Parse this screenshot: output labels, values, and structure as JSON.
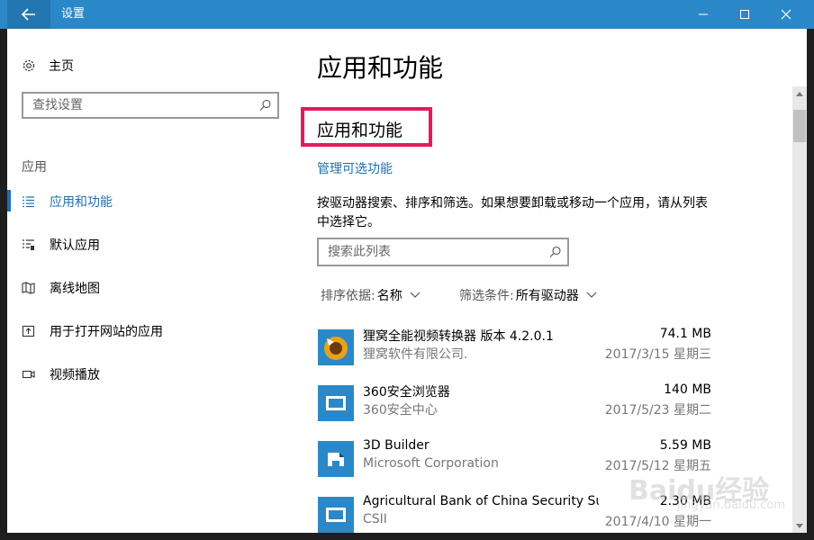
{
  "window": {
    "title": "设置"
  },
  "sidebar": {
    "home_label": "主页",
    "search_placeholder": "查找设置",
    "section": "应用",
    "items": [
      {
        "label": "应用和功能",
        "icon": "list-icon",
        "active": true
      },
      {
        "label": "默认应用",
        "icon": "default-apps-icon",
        "active": false
      },
      {
        "label": "离线地图",
        "icon": "map-icon",
        "active": false
      },
      {
        "label": "用于打开网站的应用",
        "icon": "open-website-icon",
        "active": false
      },
      {
        "label": "视频播放",
        "icon": "video-icon",
        "active": false
      }
    ]
  },
  "main": {
    "page_title": "应用和功能",
    "section_title": "应用和功能",
    "manage_link": "管理可选功能",
    "description": "按驱动器搜索、排序和筛选。如果想要卸载或移动一个应用，请从列表中选择它。",
    "list_search_placeholder": "搜索此列表",
    "sort_label": "排序依据:",
    "sort_value": "名称",
    "filter_label": "筛选条件:",
    "filter_value": "所有驱动器",
    "apps": [
      {
        "name": "狸窝全能视频转换器 版本 4.2.0.1",
        "publisher": "狸窝软件有限公司.",
        "size": "74.1 MB",
        "date": "2017/3/15 星期三"
      },
      {
        "name": "360安全浏览器",
        "publisher": "360安全中心",
        "size": "140 MB",
        "date": "2017/5/23 星期二"
      },
      {
        "name": "3D Builder",
        "publisher": "Microsoft Corporation",
        "size": "5.59 MB",
        "date": "2017/5/12 星期五"
      },
      {
        "name": "Agricultural Bank of China Security Su...",
        "publisher": "CSII",
        "size": "2.30 MB",
        "date": "2017/4/10 星期一"
      }
    ]
  },
  "watermark": {
    "text": "Baidu经验",
    "sub": "jingyan.baidu.com"
  },
  "colors": {
    "titlebar": "#2b88c8",
    "accent": "#1e70b0",
    "highlight": "#e6195a"
  }
}
